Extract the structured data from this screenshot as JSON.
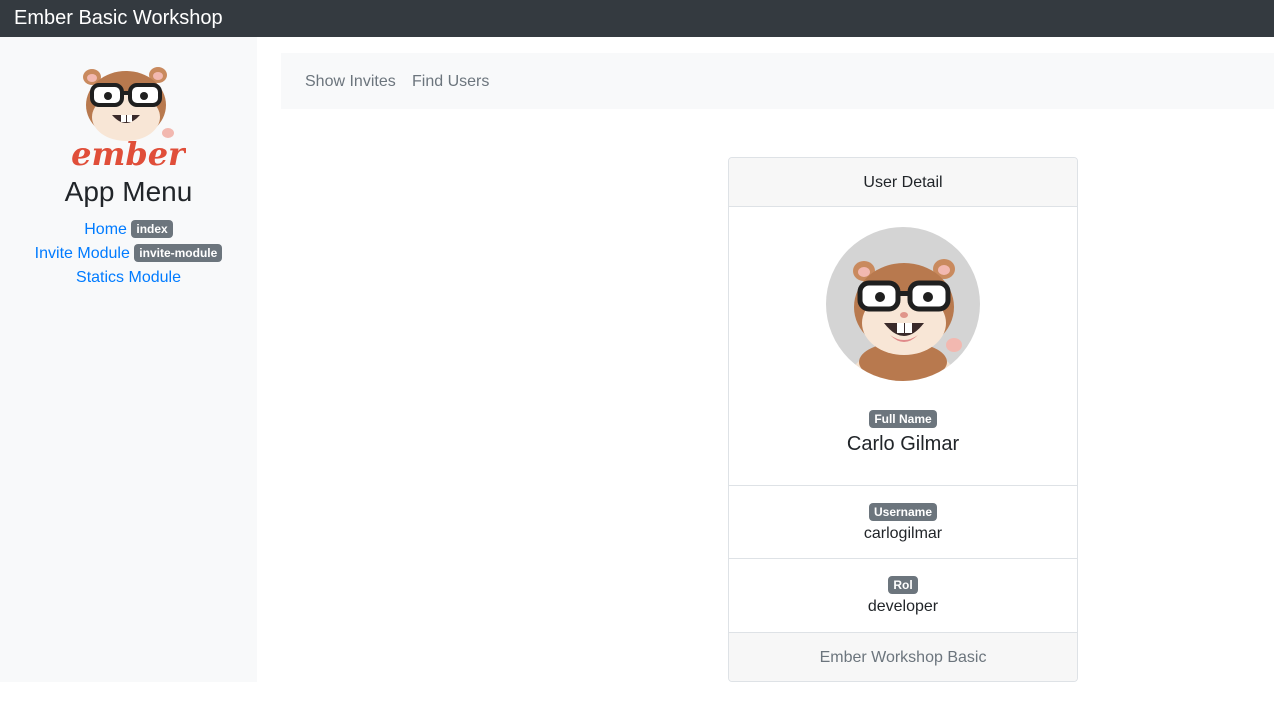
{
  "navbar": {
    "brand": "Ember Basic Workshop"
  },
  "sidebar": {
    "logo_icon": "ember-hamster-logo",
    "logo_text": "ember",
    "title": "App Menu",
    "items": [
      {
        "label": "Home",
        "badge": "index"
      },
      {
        "label": "Invite Module",
        "badge": "invite-module"
      },
      {
        "label": "Statics Module",
        "badge": ""
      }
    ]
  },
  "subnav": {
    "items": [
      "Show Invites",
      "Find Users"
    ]
  },
  "card": {
    "header": "User Detail",
    "avatar_icon": "ember-hamster-avatar",
    "fields": [
      {
        "label": "Full Name",
        "value": "Carlo Gilmar"
      },
      {
        "label": "Username",
        "value": "carlogilmar"
      },
      {
        "label": "Rol",
        "value": "developer"
      }
    ],
    "footer": "Ember Workshop Basic"
  },
  "colors": {
    "navbar_bg": "#343a40",
    "link": "#007bff",
    "badge_bg": "#6c757d",
    "sidebar_bg": "#f8f9fa",
    "ember_red": "#e04e39"
  }
}
